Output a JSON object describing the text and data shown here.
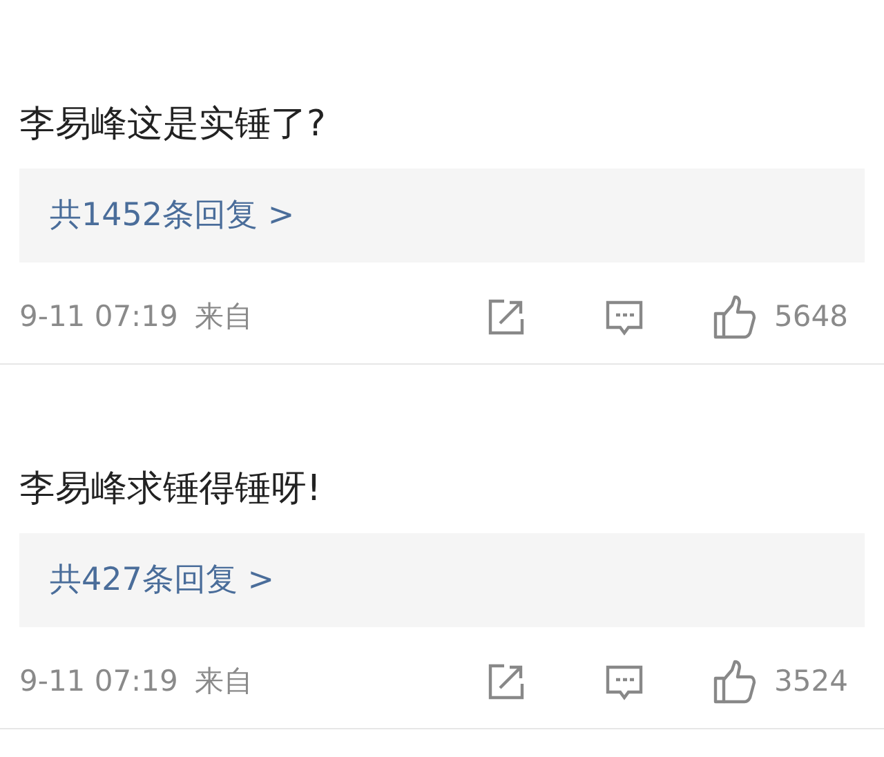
{
  "comments": [
    {
      "text": "李易峰这是实锤了?",
      "replies": "共1452条回复 >",
      "time": "9-11 07:19",
      "source": "来自",
      "likes": "5648"
    },
    {
      "text": "李易峰求锤得锤呀!",
      "replies": "共427条回复 >",
      "time": "9-11 07:19",
      "source": "来自",
      "likes": "3524"
    }
  ]
}
